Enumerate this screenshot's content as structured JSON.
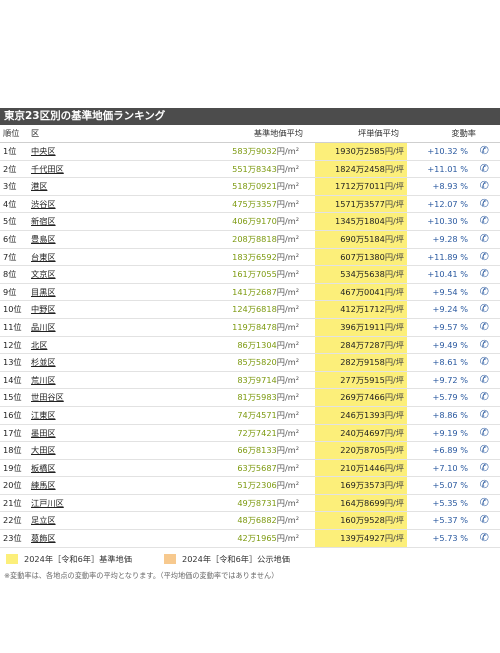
{
  "title": "東京23区別の基準地価ランキング",
  "headers": {
    "rank": "順位",
    "ward": "区",
    "kijun": "基準地価平均",
    "tsubo": "坪単価平均",
    "rate": "変動率"
  },
  "rows": [
    {
      "rank": "1位",
      "ward": "中央区",
      "kijun": "583万9032",
      "tsubo": "1930万2585",
      "rate": "+10.32 %"
    },
    {
      "rank": "2位",
      "ward": "千代田区",
      "kijun": "551万8343",
      "tsubo": "1824万2458",
      "rate": "+11.01 %"
    },
    {
      "rank": "3位",
      "ward": "港区",
      "kijun": "518万0921",
      "tsubo": "1712万7011",
      "rate": "+8.93 %"
    },
    {
      "rank": "4位",
      "ward": "渋谷区",
      "kijun": "475万3357",
      "tsubo": "1571万3577",
      "rate": "+12.07 %"
    },
    {
      "rank": "5位",
      "ward": "新宿区",
      "kijun": "406万9170",
      "tsubo": "1345万1804",
      "rate": "+10.30 %"
    },
    {
      "rank": "6位",
      "ward": "豊島区",
      "kijun": "208万8818",
      "tsubo": "690万5184",
      "rate": "+9.28 %"
    },
    {
      "rank": "7位",
      "ward": "台東区",
      "kijun": "183万6592",
      "tsubo": "607万1380",
      "rate": "+11.89 %"
    },
    {
      "rank": "8位",
      "ward": "文京区",
      "kijun": "161万7055",
      "tsubo": "534万5638",
      "rate": "+10.41 %"
    },
    {
      "rank": "9位",
      "ward": "目黒区",
      "kijun": "141万2687",
      "tsubo": "467万0041",
      "rate": "+9.54 %"
    },
    {
      "rank": "10位",
      "ward": "中野区",
      "kijun": "124万6818",
      "tsubo": "412万1712",
      "rate": "+9.24 %"
    },
    {
      "rank": "11位",
      "ward": "品川区",
      "kijun": "119万8478",
      "tsubo": "396万1911",
      "rate": "+9.57 %"
    },
    {
      "rank": "12位",
      "ward": "北区",
      "kijun": "86万1304",
      "tsubo": "284万7287",
      "rate": "+9.49 %"
    },
    {
      "rank": "13位",
      "ward": "杉並区",
      "kijun": "85万5820",
      "tsubo": "282万9158",
      "rate": "+8.61 %"
    },
    {
      "rank": "14位",
      "ward": "荒川区",
      "kijun": "83万9714",
      "tsubo": "277万5915",
      "rate": "+9.72 %"
    },
    {
      "rank": "15位",
      "ward": "世田谷区",
      "kijun": "81万5983",
      "tsubo": "269万7466",
      "rate": "+5.79 %"
    },
    {
      "rank": "16位",
      "ward": "江東区",
      "kijun": "74万4571",
      "tsubo": "246万1393",
      "rate": "+8.86 %"
    },
    {
      "rank": "17位",
      "ward": "墨田区",
      "kijun": "72万7421",
      "tsubo": "240万4697",
      "rate": "+9.19 %"
    },
    {
      "rank": "18位",
      "ward": "大田区",
      "kijun": "66万8133",
      "tsubo": "220万8705",
      "rate": "+6.89 %"
    },
    {
      "rank": "19位",
      "ward": "板橋区",
      "kijun": "63万5687",
      "tsubo": "210万1446",
      "rate": "+7.10 %"
    },
    {
      "rank": "20位",
      "ward": "練馬区",
      "kijun": "51万2306",
      "tsubo": "169万3573",
      "rate": "+5.07 %"
    },
    {
      "rank": "21位",
      "ward": "江戸川区",
      "kijun": "49万8731",
      "tsubo": "164万8699",
      "rate": "+5.35 %"
    },
    {
      "rank": "22位",
      "ward": "足立区",
      "kijun": "48万6882",
      "tsubo": "160万9528",
      "rate": "+5.37 %"
    },
    {
      "rank": "23位",
      "ward": "葛飾区",
      "kijun": "42万1965",
      "tsubo": "139万4927",
      "rate": "+5.73 %"
    }
  ],
  "units": {
    "kijun": "円/m²",
    "tsubo": "円/坪"
  },
  "legend": {
    "kijun": "2024年［令和6年］基準地価",
    "koji": "2024年［令和6年］公示地価"
  },
  "note": "※変動率は、各地点の変動率の平均となります。（平均地価の変動率ではありません）",
  "colors": {
    "kijun_swatch": "#fcef7a",
    "koji_swatch": "#f7c98e",
    "rate_text": "#2b5aa0",
    "kijun_text": "#7d9a10"
  },
  "icons": {
    "rate_row": "phone-icon"
  }
}
